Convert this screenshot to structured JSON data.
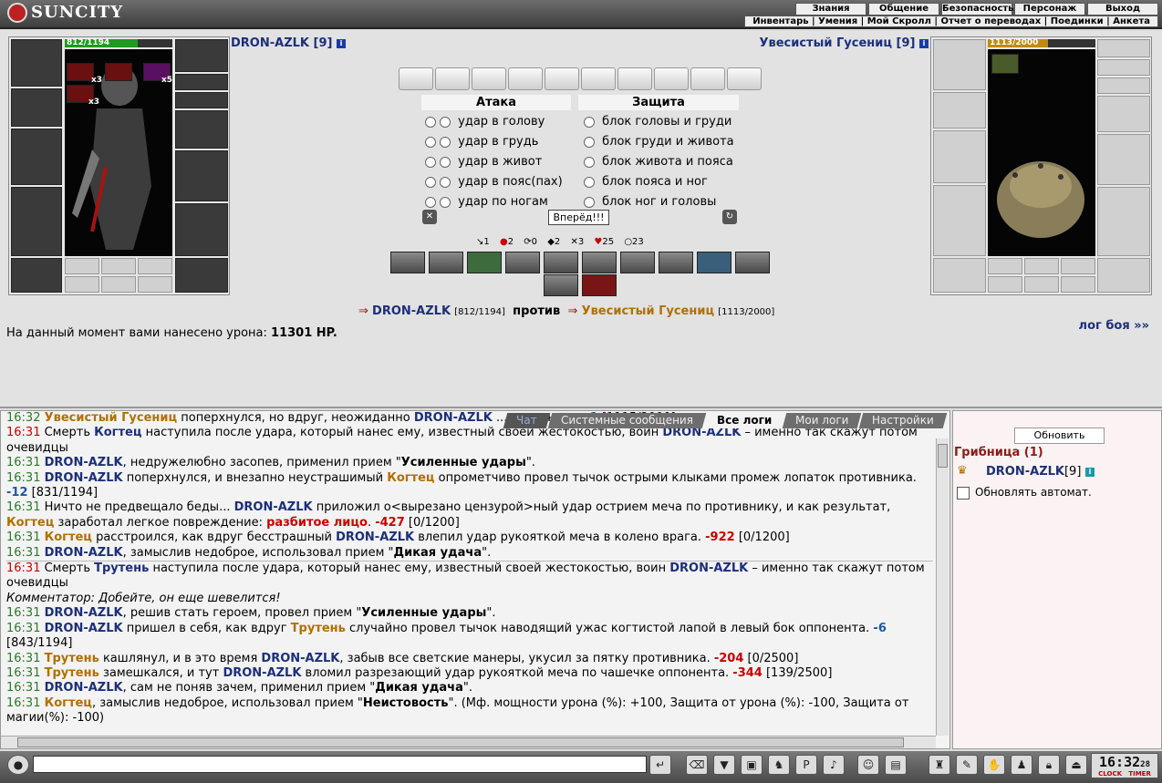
{
  "header": {
    "logo_text": "SUNCITY",
    "menu": [
      "Знания",
      "Общение",
      "Безопасность",
      "Персонаж",
      "Выход"
    ],
    "submenu": "Инвентарь | Умения | Мой Скролл | Отчет о переводах | Поединки | Анкета"
  },
  "player": {
    "name": "DRON-AZLK",
    "level": "[9]",
    "hp": "812/1194",
    "hp_fraction": 0.68,
    "stack_labels": [
      "x3",
      "x5",
      "x3"
    ]
  },
  "enemy": {
    "name": "Увесистый Гусениц",
    "level": "[9]",
    "hp": "1113/2000",
    "hp_fraction": 0.56
  },
  "attack": {
    "title": "Атака",
    "options": [
      "удар в голову",
      "удар в грудь",
      "удар в живот",
      "удар в пояс(пах)",
      "удар по ногам"
    ]
  },
  "defense": {
    "title": "Защита",
    "options": [
      "блок головы и груди",
      "блок груди и живота",
      "блок живота и пояса",
      "блок пояса и ног",
      "блок ног и головы"
    ]
  },
  "forward_button": "Вперёд!!!",
  "stats": [
    "1",
    "2",
    "0",
    "2",
    "3",
    "25",
    "23"
  ],
  "versus": {
    "player_name": "DRON-AZLK",
    "player_hp": "[812/1194]",
    "word": "против",
    "enemy_name": "Увесистый Гусениц",
    "enemy_hp": "[1113/2000]"
  },
  "damage": {
    "label": "На данный момент вами нанесено урона:",
    "value": "11301 HP."
  },
  "log_link": "лог боя »»",
  "tabs": [
    "Чат",
    "Системные сообщения",
    "Все логи",
    "Мои логи",
    "Настройки"
  ],
  "log": [
    {
      "time": "16:32",
      "parts": [
        "Увесистый Гусениц",
        " поперхнулся, но вдруг, неожиданно ",
        "DRON-AZLK",
        " ... соперника. ",
        "-1",
        " [1115/2000]"
      ]
    },
    {
      "time": "16:31",
      "text_a": "Смерть ",
      "who": "Когтец",
      "text_b": " наступила после удара, который нанес ему, известный своей жестокостью, воин ",
      "killer": "DRON-AZLK",
      "text_c": " – именно так скажут потом очевидцы"
    },
    {
      "time": "16:31",
      "who": "DRON-AZLK",
      "text": ", недружелюбно засопев, применил прием \"",
      "tech": "Усиленные удары",
      "end": "\"."
    },
    {
      "time": "16:31",
      "who": "DRON-AZLK",
      "text": " поперхнулся, и внезапно неустрашимый ",
      "foe": "Когтец",
      "text2": " опрометчиво провел тычок острыми клыками промеж лопаток противника. ",
      "dmg": "-12",
      "hp": " [831/1194]"
    },
    {
      "time": "16:31",
      "text": "Ничто не предвещало беды... ",
      "who": "DRON-AZLK",
      "text2": " приложил о<вырезано цензурой>ный удар острием меча по противнику, и как результат, ",
      "foe": "Когтец",
      "text3": " заработал легкое повреждение: ",
      "hurt": "разбитое лицо",
      "dmg": "-427",
      "hp": " [0/1200]"
    },
    {
      "time": "16:31",
      "foe": "Когтец",
      "text": " расстроился, как вдруг бесстрашный ",
      "who": "DRON-AZLK",
      "text2": " влепил удар рукояткой меча в колено врага. ",
      "dmg": "-922",
      "hp": " [0/1200]"
    },
    {
      "time": "16:31",
      "who": "DRON-AZLK",
      "text": ", замыслив недоброе, использовал прием \"",
      "tech": "Дикая удача",
      "end": "\"."
    },
    {
      "time": "16:31",
      "text_a": "Смерть ",
      "who": "Трутень",
      "text_b": " наступила после удара, который нанес ему, известный своей жестокостью, воин ",
      "killer": "DRON-AZLK",
      "text_c": " – именно так скажут потом очевидцы"
    },
    {
      "comment": "Комментатор: Добейте, он еще шевелится!"
    },
    {
      "time": "16:31",
      "who": "DRON-AZLK",
      "text": ", решив стать героем, провел прием \"",
      "tech": "Усиленные удары",
      "end": "\"."
    },
    {
      "time": "16:31",
      "who": "DRON-AZLK",
      "text": " пришел в себя, как вдруг ",
      "foe": "Трутень",
      "text2": " случайно провел тычок наводящий ужас когтистой лапой в левый бок оппонента. ",
      "dmg": "-6",
      "hp": " [843/1194]"
    },
    {
      "time": "16:31",
      "foe": "Трутень",
      "text": " кашлянул, и в это время ",
      "who": "DRON-AZLK",
      "text2": ", забыв все светские манеры, укусил за пятку противника. ",
      "dmg": "-204",
      "hp": " [0/2500]"
    },
    {
      "time": "16:31",
      "foe": "Трутень",
      "text": " замешкался, и тут ",
      "who": "DRON-AZLK",
      "text2": " вломил разрезающий удар рукояткой меча по чашечке оппонента. ",
      "dmg": "-344",
      "hp": " [139/2500]"
    },
    {
      "time": "16:31",
      "who": "DRON-AZLK",
      "text": ", сам не поняв зачем, применил прием \"",
      "tech": "Дикая удача",
      "end": "\"."
    },
    {
      "time": "16:31",
      "foe": "Когтец",
      "text": ", замыслив недоброе, использовал прием \"",
      "tech": "Неистовость",
      "end": "\". (Мф. мощности урона (%): +100, Защита от урона (%): -100, Защита от магии(%): -100)"
    }
  ],
  "side": {
    "refresh_button": "Обновить",
    "room_title": "Грибница (1)",
    "online_user": "DRON-AZLK",
    "online_level": "[9]",
    "auto_label": "Обновлять автомат."
  },
  "clock": {
    "time": "16:32",
    "seconds": "28",
    "labels": [
      "CLOCK",
      "TIMER"
    ]
  },
  "colors": {
    "player": "#1c2f7a",
    "enemy": "#b07000",
    "damage": "#cc0000",
    "time": "#2a7a2a"
  }
}
